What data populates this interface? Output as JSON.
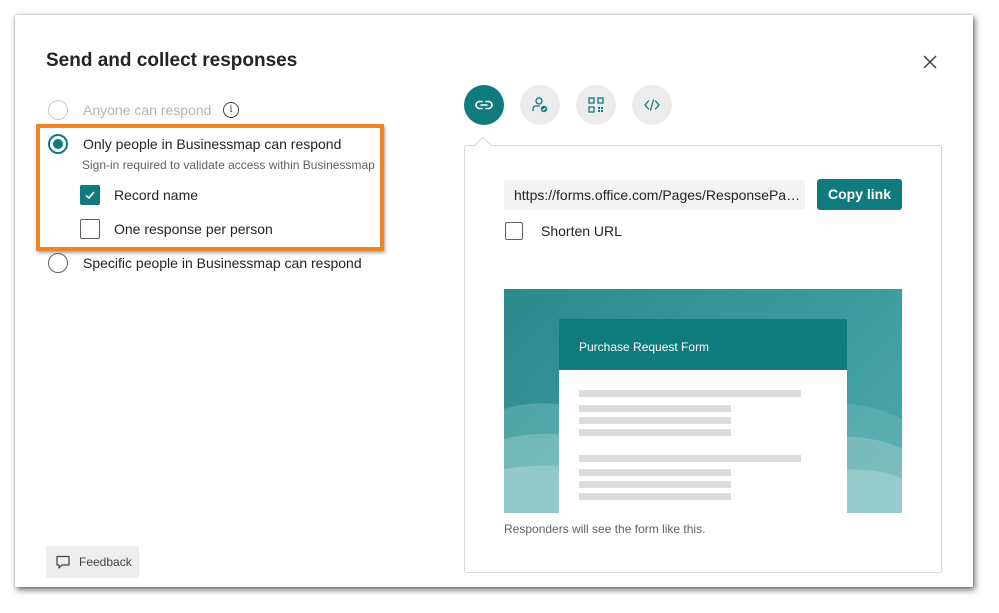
{
  "dialog": {
    "title": "Send and collect responses",
    "close_icon": "close-icon"
  },
  "options": {
    "anyone": {
      "label": "Anyone can respond",
      "selected": false,
      "disabled": true
    },
    "org": {
      "label": "Only people in Businessmap can respond",
      "sublabel": "Sign-in required to validate access within Businessmap",
      "selected": true,
      "record_name": {
        "label": "Record name",
        "checked": true
      },
      "one_response": {
        "label": "One response per person",
        "checked": false
      }
    },
    "specific": {
      "label": "Specific people in Businessmap can respond",
      "selected": false
    }
  },
  "feedback": {
    "label": "Feedback",
    "icon": "comment-icon"
  },
  "share_tabs": [
    {
      "icon": "link-icon",
      "active": true
    },
    {
      "icon": "person-add-icon",
      "active": false
    },
    {
      "icon": "qr-code-icon",
      "active": false
    },
    {
      "icon": "embed-code-icon",
      "active": false
    }
  ],
  "link": {
    "url": "https://forms.office.com/Pages/ResponsePag ...",
    "copy_label": "Copy link",
    "shorten_label": "Shorten URL",
    "shorten_checked": false
  },
  "preview": {
    "form_title": "Purchase Request Form",
    "caption": "Responders will see the form like this."
  },
  "colors": {
    "accent": "#0f7b7c",
    "highlight": "#ef8423"
  }
}
